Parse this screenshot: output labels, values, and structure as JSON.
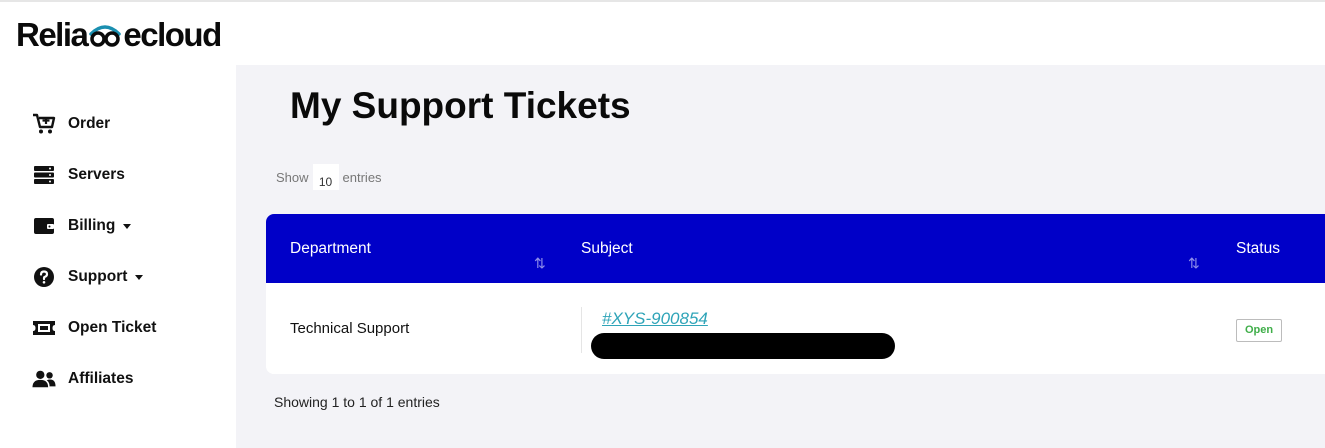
{
  "brand": {
    "logo_left": "Relia",
    "logo_right": "ecloud"
  },
  "sidebar": {
    "items": [
      {
        "label": "Order",
        "icon": "cart-plus-icon"
      },
      {
        "label": "Servers",
        "icon": "server-icon"
      },
      {
        "label": "Billing",
        "icon": "wallet-icon",
        "dropdown": true
      },
      {
        "label": "Support",
        "icon": "question-circle-icon",
        "dropdown": true
      },
      {
        "label": "Open Ticket",
        "icon": "ticket-icon"
      },
      {
        "label": "Affiliates",
        "icon": "users-icon"
      }
    ]
  },
  "page": {
    "title": "My Support Tickets"
  },
  "table_controls": {
    "show_label": "Show",
    "page_length": "10",
    "entries_label": "entries",
    "info": "Showing 1 to 1 of 1 entries"
  },
  "table": {
    "columns": [
      "Department",
      "Subject",
      "Status"
    ],
    "rows": [
      {
        "department": "Technical Support",
        "ticket_id": "#XYS-900854",
        "status": "Open"
      }
    ]
  },
  "colors": {
    "table_header": "#0000c8",
    "link": "#2fa4b8",
    "status_open": "#3fae49",
    "main_bg": "#f3f3f7"
  }
}
